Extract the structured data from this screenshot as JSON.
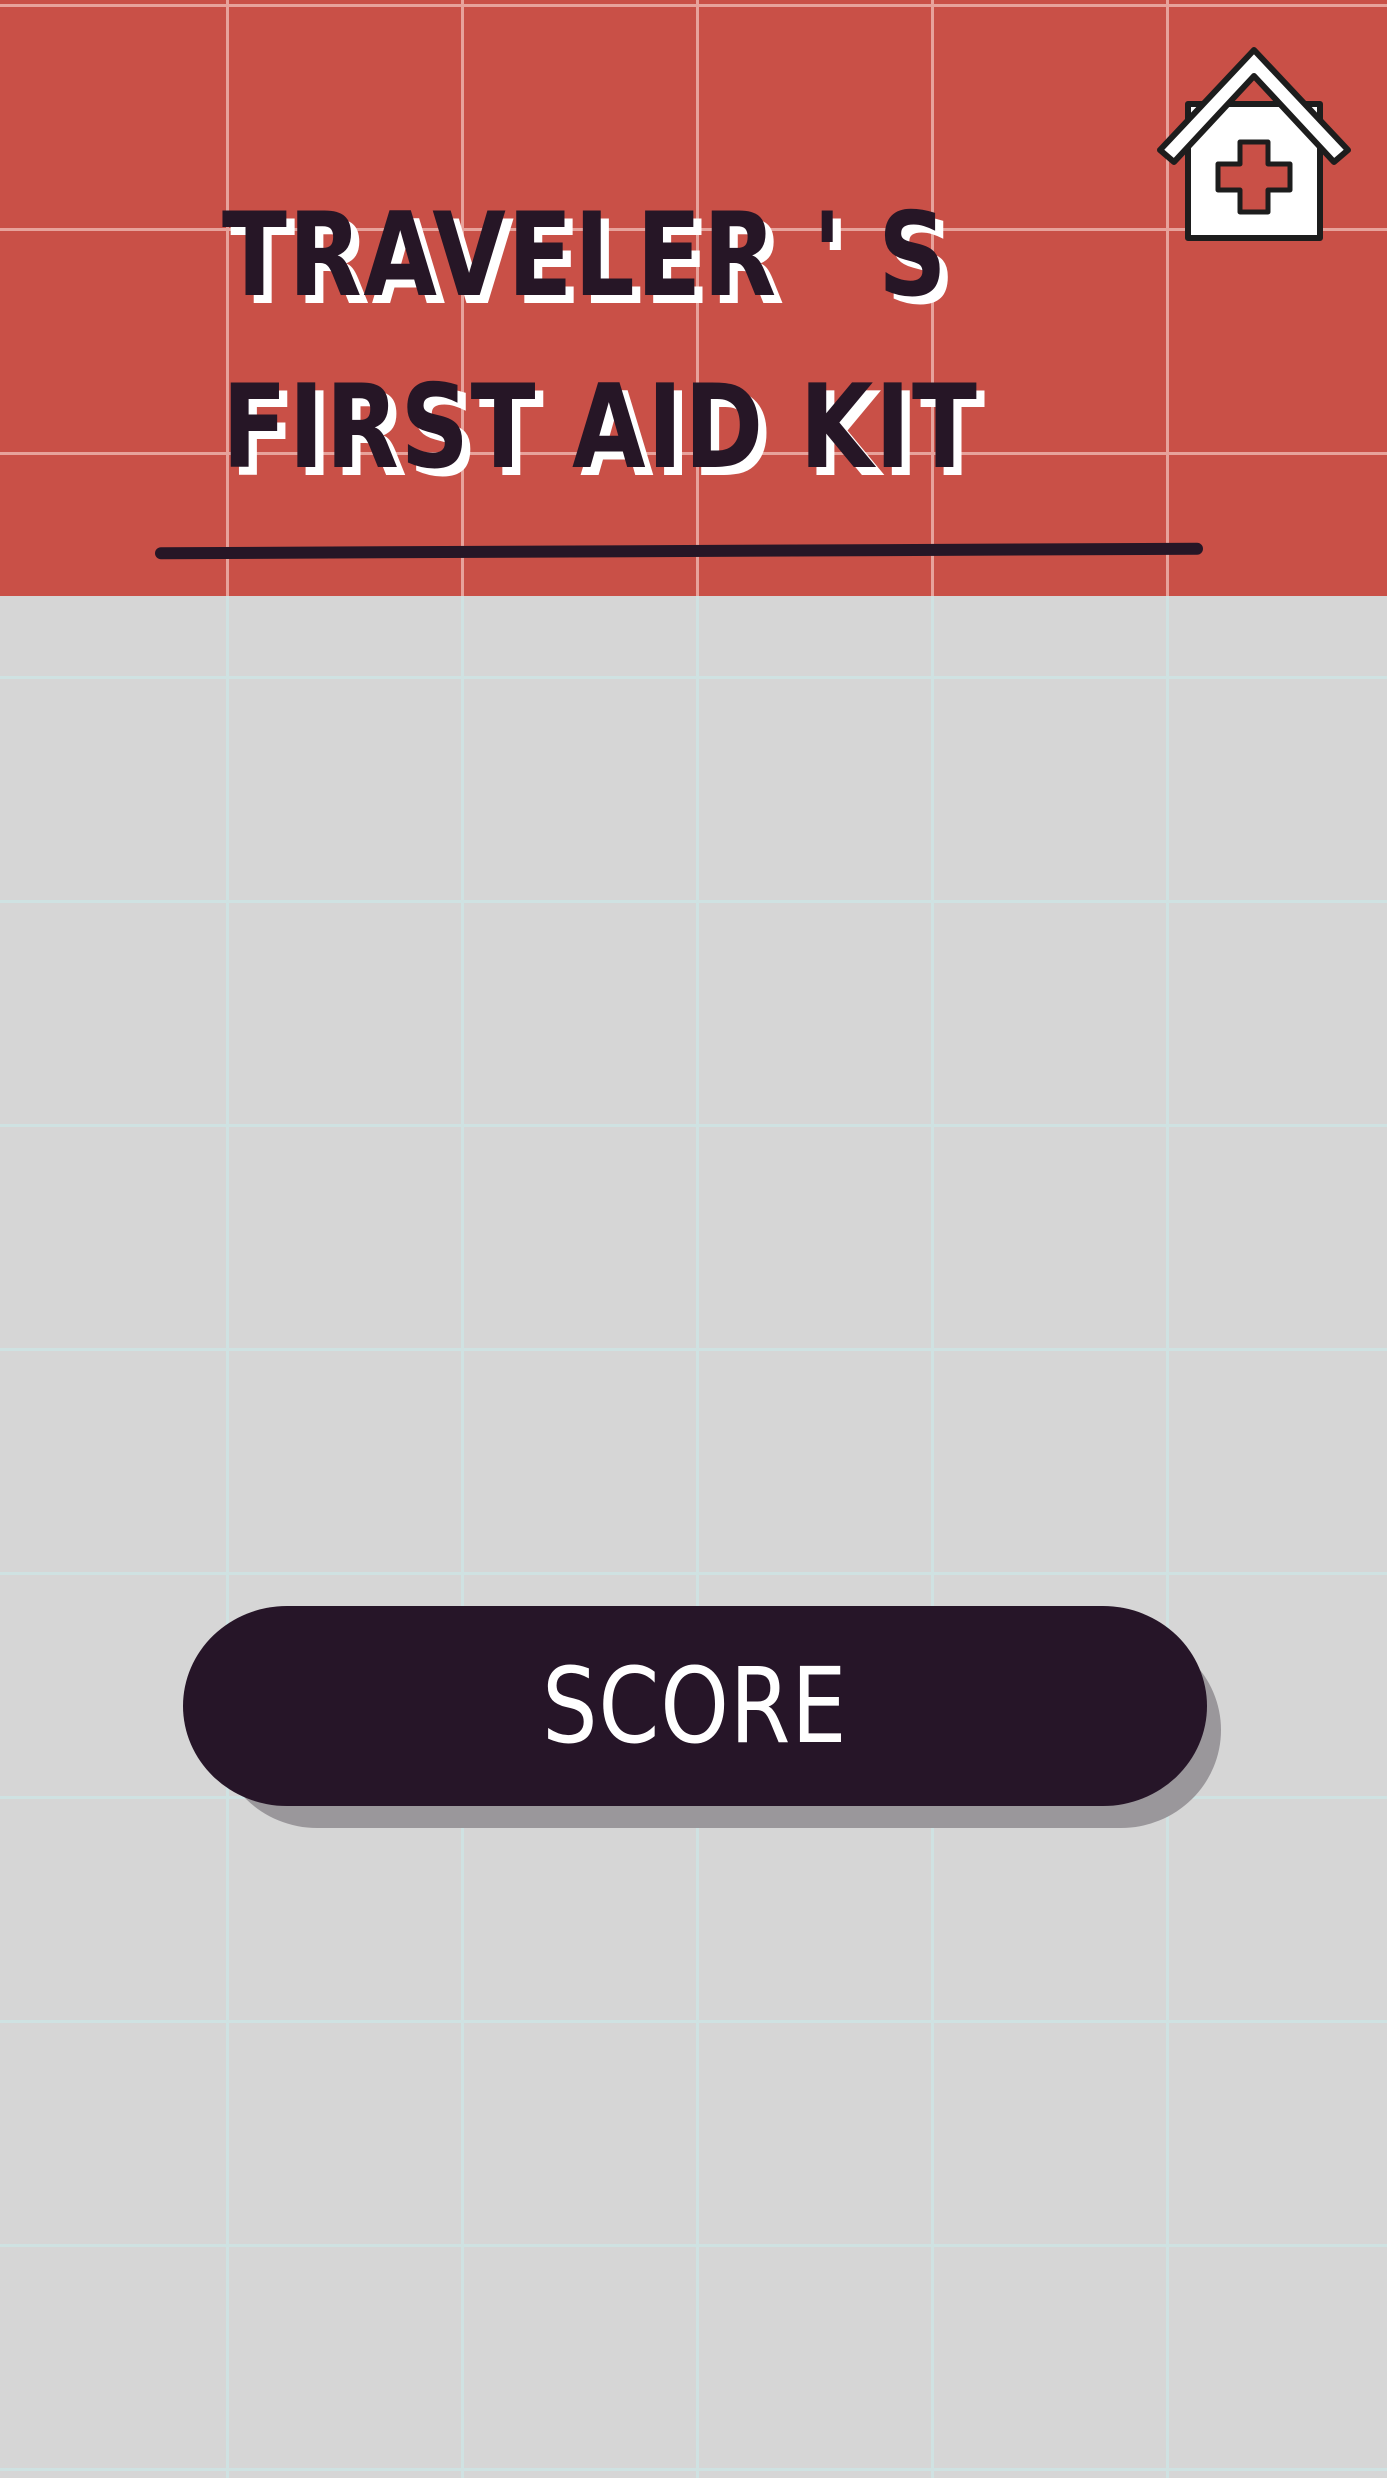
{
  "title": {
    "line1": "TRAVELER ' S",
    "line2": "FIRST AID KIT"
  },
  "icons": {
    "home": "house-medical-cross-icon"
  },
  "score_button": {
    "label": "SCORE"
  },
  "colors": {
    "header_background": "#c95047",
    "page_background": "#d6d6d6",
    "grid_line": "#cfe2e2",
    "dark_ink": "#261528",
    "button_shadow": "#9a979b",
    "cross_red": "#c95047"
  }
}
